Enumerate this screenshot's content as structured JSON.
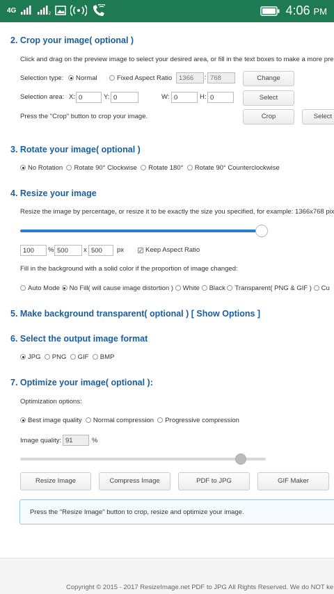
{
  "status_bar": {
    "network": "4G",
    "time": "4:06",
    "ampm": "PM"
  },
  "crop": {
    "heading": "2. Crop your image( optional )",
    "description": "Click and drag on the preview image to select your desired area, or fill in the text boxes to make a more pre",
    "selection_type_label": "Selection type:",
    "normal_label": "Normal",
    "fixed_ratio_label": "Fixed Aspect Ratio",
    "ratio_width": "1366",
    "ratio_sep": ":",
    "ratio_height": "768",
    "change_button": "Change",
    "selection_area_label": "Selection area:",
    "x_label": "X:",
    "x_value": "0",
    "y_label": "Y:",
    "y_value": "0",
    "w_label": "W:",
    "w_value": "0",
    "h_label": "H:",
    "h_value": "0",
    "select_button": "Select",
    "crop_note": "Press the \"Crop\" button to crop your image.",
    "crop_button": "Crop",
    "select_all_button": "Select"
  },
  "rotate": {
    "heading": "3. Rotate your image( optional )",
    "options": [
      "No Rotation",
      "Rotate 90° Clockwise",
      "Rotate 180°",
      "Rotate 90° Counterclockwise"
    ],
    "selected": 0
  },
  "resize": {
    "heading": "4. Resize your image",
    "description": "Resize the image by percentage, or resize it to be exactly the size you specified, for example: 1366x768 pix",
    "slider_value": 1.0,
    "percent_value": "100",
    "percent_unit": "%",
    "width_value": "500",
    "x_sep": "x",
    "height_value": "500",
    "px_unit": "px",
    "keep_aspect_label": "Keep Aspect Ratio",
    "keep_aspect_checked": true,
    "fill_description": "Fill in the background with a solid color if the proportion of image changed:",
    "fill_options": [
      "Auto Mode",
      "No Fill( will cause image distortion )",
      "White",
      "Black",
      "Transparent( PNG & GIF )",
      "Cu"
    ],
    "fill_selected": 1
  },
  "transparent": {
    "heading": "5. Make background transparent( optional )",
    "show_options": "[ Show Options ]"
  },
  "format": {
    "heading": "6. Select the output image format",
    "options": [
      "JPG",
      "PNG",
      "GIF",
      "BMP"
    ],
    "selected": 0
  },
  "optimize": {
    "heading": "7. Optimize your image( optional ):",
    "options_label": "Optimization options:",
    "options": [
      "Best image quality",
      "Normal compression",
      "Progressive compression"
    ],
    "selected": 0,
    "quality_label": "Image quality:",
    "quality_value": "91",
    "quality_unit": "%",
    "quality_slider": 0.91
  },
  "actions": {
    "resize_button": "Resize Image",
    "compress_button": "Compress Image",
    "pdf_button": "PDF to JPG",
    "gif_button": "GIF Maker"
  },
  "info_text": "Press the \"Resize Image\" button to crop, resize and optimize your image.",
  "footer_text": "Copyright © 2015 - 2017  ResizeImage.net  PDF to JPG  All Rights Reserved. We do NOT ke",
  "colors": {
    "status_bar": "#1e7a52",
    "heading": "#1a5d9c",
    "slider_fill": "#2a7bd3"
  }
}
